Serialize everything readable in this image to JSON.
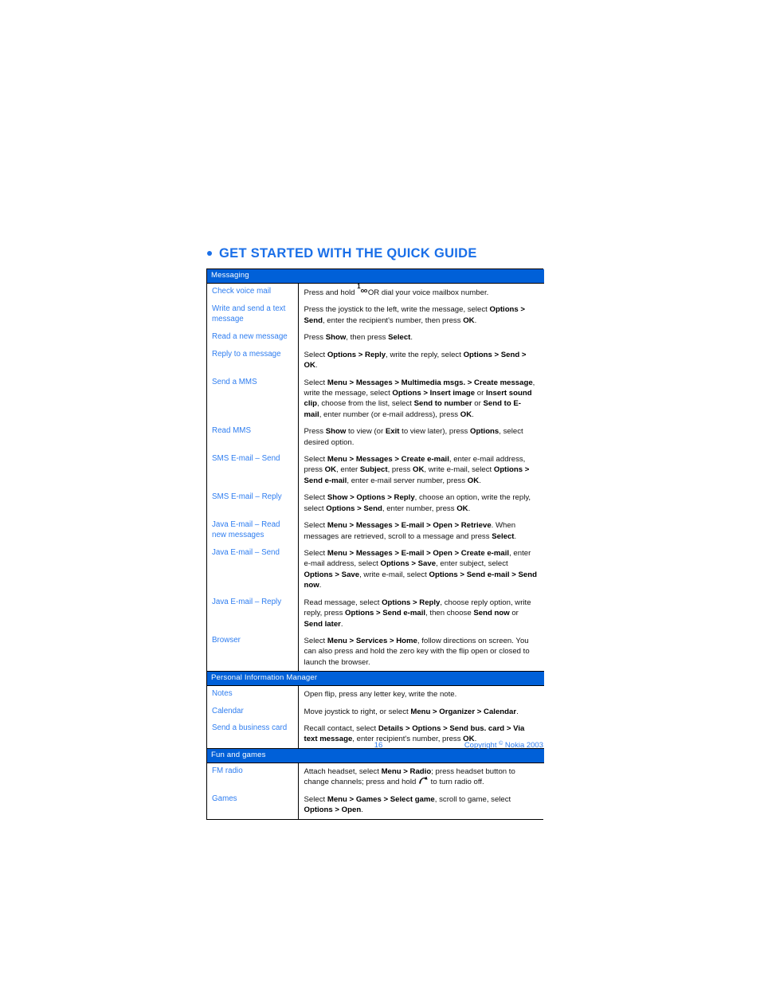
{
  "page": {
    "title": "GET STARTED WITH THE QUICK GUIDE",
    "title_color": "#1a6fe8",
    "accent_color": "#0060d8",
    "label_color": "#2e7df0",
    "footer": {
      "page_number": "16",
      "copyright_prefix": "Copyright ",
      "copyright_symbol": "©",
      "copyright_suffix": " Nokia 2003"
    }
  },
  "table": {
    "sections": [
      {
        "heading": "Messaging",
        "rows": [
          {
            "label": "Check voice mail",
            "body_html": "Press and hold <span class=\"key-voicemail\" data-name=\"voicemail-key-icon\" data-interactable=\"false\"><span class=\"k1\">1</span><span class=\"koo\">oo</span></span> OR dial your voice mailbox number.",
            "body_text": "Press and hold 1oo OR dial your voice mailbox number."
          },
          {
            "label": "Write and send a text message",
            "body_html": "Press the joystick to the left, write the message, select <b>Options &gt; Send</b>, enter the recipient's number, then press <b>OK</b>.",
            "body_text": "Press the joystick to the left, write the message, select Options > Send, enter the recipient's number, then press OK."
          },
          {
            "label": "Read a new message",
            "body_html": "Press <b>Show</b>, then press <b>Select</b>.",
            "body_text": "Press Show, then press Select."
          },
          {
            "label": "Reply to a message",
            "body_html": "Select <b>Options &gt; Reply</b>, write the reply, select <b>Options &gt; Send &gt; OK</b>.",
            "body_text": "Select Options > Reply, write the reply, select Options > Send > OK."
          },
          {
            "label": "Send a MMS",
            "body_html": "Select <b>Menu &gt; Messages &gt; Multimedia msgs. &gt; Create message</b>, write the message, select <b>Options &gt; Insert image</b> or <b>Insert sound clip</b>, choose from the list, select <b>Send to number</b> or <b>Send to E-mail</b>, enter number (or e-mail address), press <b>OK</b>.",
            "body_text": "Select Menu > Messages > Multimedia msgs. > Create message, write the message, select Options > Insert image or Insert sound clip, choose from the list, select Send to number or Send to E-mail, enter number (or e-mail address), press OK."
          },
          {
            "label": "Read MMS",
            "body_html": "Press <b>Show</b> to view (or <b>Exit</b> to view later), press <b>Options</b>, select desired option.",
            "body_text": "Press Show to view (or Exit to view later), press Options, select desired option."
          },
          {
            "label": "SMS E-mail – Send",
            "body_html": "Select <b>Menu &gt; Messages &gt; Create e-mail</b>, enter e-mail address, press <b>OK</b>, enter <b>Subject</b>, press <b>OK</b>, write e-mail, select <b>Options &gt; Send e-mail</b>, enter e-mail server number, press <b>OK</b>.",
            "body_text": "Select Menu > Messages > Create e-mail, enter e-mail address, press OK, enter Subject, press OK, write e-mail, select Options > Send e-mail, enter e-mail server number, press OK."
          },
          {
            "label": "SMS E-mail – Reply",
            "body_html": "Select <b>Show &gt; Options &gt; Reply</b>, choose an option, write the reply, select <b>Options &gt; Send</b>, enter number, press <b>OK</b>.",
            "body_text": "Select Show > Options > Reply, choose an option, write the reply, select Options > Send, enter number, press OK."
          },
          {
            "label": "Java E-mail – Read new messages",
            "body_html": "Select <b>Menu &gt; Messages &gt; E-mail &gt; Open &gt; Retrieve</b>. When messages are retrieved, scroll to a message and press <b>Select</b>.",
            "body_text": "Select Menu > Messages > E-mail > Open > Retrieve. When messages are retrieved, scroll to a message and press Select."
          },
          {
            "label": "Java E-mail – Send",
            "body_html": "Select <b>Menu &gt; Messages &gt; E-mail &gt; Open &gt; Create e-mail</b>, enter e-mail address, select <b>Options &gt; Save</b>, enter subject, select <b>Options &gt; Save</b>, write e-mail, select <b>Options &gt; Send e-mail &gt; Send now</b>.",
            "body_text": "Select Menu > Messages > E-mail > Open > Create e-mail, enter e-mail address, select Options > Save, enter subject, select Options > Save, write e-mail, select Options > Send e-mail > Send now."
          },
          {
            "label": "Java E-mail – Reply",
            "body_html": "Read message, select <b>Options &gt; Reply</b>, choose reply option, write reply, press <b>Options &gt; Send e-mail</b>, then choose <b>Send now</b> or <b>Send later</b>.",
            "body_text": "Read message, select Options > Reply, choose reply option, write reply, press Options > Send e-mail, then choose Send now or Send later."
          },
          {
            "label": "Browser",
            "body_html": "Select <b>Menu &gt; Services &gt; Home</b>, follow directions on screen. You can also press and hold the zero key with the flip open or closed to launch the browser.",
            "body_text": "Select Menu > Services > Home, follow directions on screen. You can also press and hold the zero key with the flip open or closed to launch the browser."
          }
        ]
      },
      {
        "heading": "Personal Information Manager",
        "rows": [
          {
            "label": "Notes",
            "body_html": "Open flip, press any letter key, write the note.",
            "body_text": "Open flip, press any letter key, write the note."
          },
          {
            "label": "Calendar",
            "body_html": "Move joystick to right, or select <b>Menu &gt; Organizer &gt; Calendar</b>.",
            "body_text": "Move joystick to right, or select Menu > Organizer > Calendar."
          },
          {
            "label": "Send a business card",
            "body_html": "Recall contact, select <b>Details &gt; Options &gt; Send bus. card &gt; Via text message</b>, enter recipient's number, press <b>OK</b>.",
            "body_text": "Recall contact, select Details > Options > Send bus. card > Via text message, enter recipient's number, press OK."
          }
        ]
      },
      {
        "heading": "Fun and games",
        "rows": [
          {
            "label": "FM radio",
            "body_html": "Attach headset, select <b>Menu &gt; Radio</b>; press headset button to change channels; press and hold <span class=\"key-end\" data-name=\"end-call-key-icon\" data-interactable=\"false\"><svg width=\"13\" height=\"12\" viewBox=\"0 0 13 12\"><path d=\"M1.2 9.6 C1.2 4.4 5.0 1.4 9.0 1.9 L10.4 0.6 L11.6 4.5 L7.6 4.1 L8.8 2.9 C5.9 2.7 3.1 4.9 3.1 9.6 Z\" fill=\"#111\"/></svg></span> to turn radio off.",
            "body_text": "Attach headset, select Menu > Radio; press headset button to change channels; press and hold (end key) to turn radio off."
          },
          {
            "label": "Games",
            "body_html": "Select <b>Menu &gt; Games &gt; Select game</b>, scroll to game, select <b>Options &gt; Open</b>.",
            "body_text": "Select Menu > Games > Select game, scroll to game, select Options > Open."
          }
        ]
      }
    ]
  }
}
